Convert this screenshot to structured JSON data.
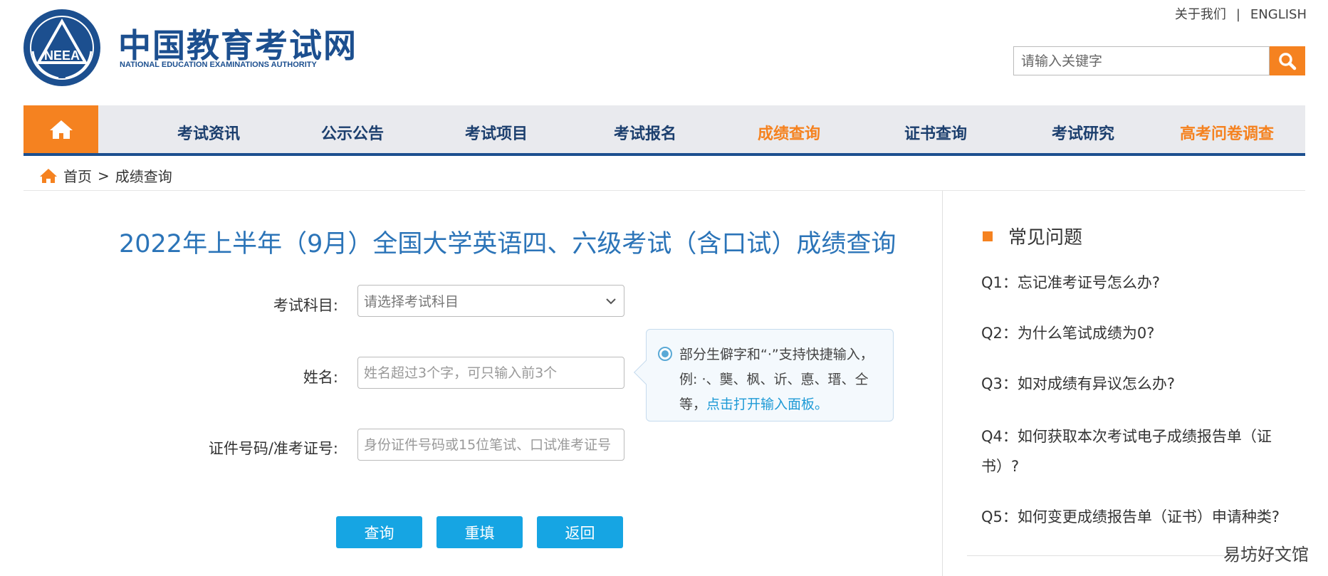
{
  "header": {
    "site_title": "中国教育考试网",
    "site_subtitle": "NATIONAL EDUCATION EXAMINATIONS AUTHORITY",
    "logo_text": "NEEA",
    "about_label": "关于我们",
    "separator": "|",
    "english_label": "ENGLISH",
    "search_placeholder": "请输入关键字"
  },
  "nav": {
    "items": [
      {
        "label": "考试资讯"
      },
      {
        "label": "公示公告"
      },
      {
        "label": "考试项目"
      },
      {
        "label": "考试报名"
      },
      {
        "label": "成绩查询"
      },
      {
        "label": "证书查询"
      },
      {
        "label": "考试研究"
      },
      {
        "label": "高考问卷调查"
      }
    ]
  },
  "breadcrumb": {
    "home": "首页",
    "separator": ">",
    "current": "成绩查询"
  },
  "main": {
    "title": "2022年上半年（9月）全国大学英语四、六级考试（含口试）成绩查询",
    "form": {
      "subject_label": "考试科目:",
      "subject_placeholder": "请选择考试科目",
      "name_label": "姓名:",
      "name_placeholder": "姓名超过3个字，可只输入前3个",
      "id_label": "证件号码/准考证号:",
      "id_placeholder": "身份证件号码或15位笔试、口试准考证号"
    },
    "tooltip": {
      "text": "部分生僻字和“·”支持快捷输入，例: ·、龑、枫、䜣、悳、瑨、仝等，",
      "link": "点击打开输入面板。"
    },
    "buttons": {
      "query": "查询",
      "reset": "重填",
      "back": "返回"
    }
  },
  "sidebar": {
    "title": "常见问题",
    "faqs": [
      "Q1：忘记准考证号怎么办?",
      "Q2：为什么笔试成绩为0?",
      "Q3：如对成绩有异议怎么办?",
      "Q4：如何获取本次考试电子成绩报告单（证书）?",
      "Q5：如何变更成绩报告单（证书）申请种类?"
    ]
  },
  "watermark": "易坊好文馆",
  "colors": {
    "brand_blue": "#1c4f8f",
    "accent_orange": "#f58220",
    "button_blue": "#16a5e3",
    "title_blue": "#2b74b8"
  }
}
